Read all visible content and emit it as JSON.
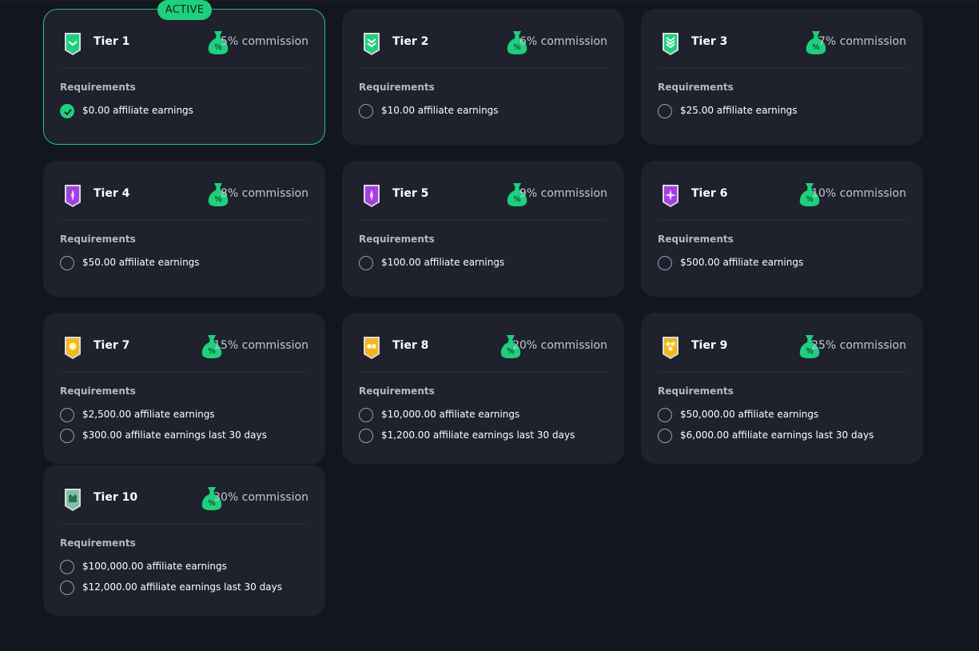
{
  "active_label": "ACTIVE",
  "requirements_heading": "Requirements",
  "colors": {
    "accent": "#1ed07e",
    "card_bg": "#1f212d",
    "page_bg": "#13151f"
  },
  "tiers": [
    {
      "name": "Tier 1",
      "commission": "5% commission",
      "icon": "chevron-shield-icon",
      "active": true,
      "requirements": [
        {
          "text": "$0.00 affiliate earnings",
          "done": true
        }
      ]
    },
    {
      "name": "Tier 2",
      "commission": "6% commission",
      "icon": "double-chevron-shield-icon",
      "active": false,
      "requirements": [
        {
          "text": "$10.00 affiliate earnings",
          "done": false
        }
      ]
    },
    {
      "name": "Tier 3",
      "commission": "7% commission",
      "icon": "triple-chevron-shield-icon",
      "active": false,
      "requirements": [
        {
          "text": "$25.00 affiliate earnings",
          "done": false
        }
      ]
    },
    {
      "name": "Tier 4",
      "commission": "8% commission",
      "icon": "purple-shield-icon",
      "active": false,
      "requirements": [
        {
          "text": "$50.00 affiliate earnings",
          "done": false
        }
      ]
    },
    {
      "name": "Tier 5",
      "commission": "9% commission",
      "icon": "purple-shield-icon",
      "active": false,
      "requirements": [
        {
          "text": "$100.00 affiliate earnings",
          "done": false
        }
      ]
    },
    {
      "name": "Tier 6",
      "commission": "10% commission",
      "icon": "purple-star-shield-icon",
      "active": false,
      "requirements": [
        {
          "text": "$500.00 affiliate earnings",
          "done": false
        }
      ]
    },
    {
      "name": "Tier 7",
      "commission": "15% commission",
      "icon": "gold-star-shield-icon",
      "active": false,
      "requirements": [
        {
          "text": "$2,500.00 affiliate earnings",
          "done": false
        },
        {
          "text": "$300.00 affiliate earnings last 30 days",
          "done": false
        }
      ]
    },
    {
      "name": "Tier 8",
      "commission": "20% commission",
      "icon": "gold-two-star-shield-icon",
      "active": false,
      "requirements": [
        {
          "text": "$10,000.00 affiliate earnings",
          "done": false
        },
        {
          "text": "$1,200.00 affiliate earnings last 30 days",
          "done": false
        }
      ]
    },
    {
      "name": "Tier 9",
      "commission": "25% commission",
      "icon": "gold-three-star-shield-icon",
      "active": false,
      "requirements": [
        {
          "text": "$50,000.00 affiliate earnings",
          "done": false
        },
        {
          "text": "$6,000.00 affiliate earnings last 30 days",
          "done": false
        }
      ]
    },
    {
      "name": "Tier 10",
      "commission": "30% commission",
      "icon": "crown-shield-icon",
      "active": false,
      "requirements": [
        {
          "text": "$100,000.00 affiliate earnings",
          "done": false
        },
        {
          "text": "$12,000.00 affiliate earnings last 30 days",
          "done": false
        }
      ]
    }
  ]
}
